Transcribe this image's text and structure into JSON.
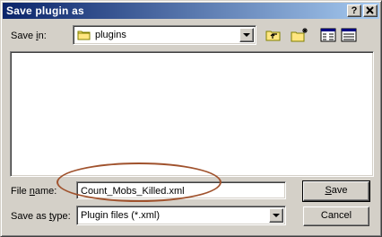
{
  "window": {
    "title": "Save plugin as",
    "help_glyph": "?",
    "close_glyph": "✕"
  },
  "save_in": {
    "label_pre": "Save ",
    "label_accel": "i",
    "label_post": "n:",
    "value": "plugins",
    "icon": "folder-icon"
  },
  "toolbar": {
    "up_folder_icon": "up-one-level-icon",
    "new_folder_icon": "new-folder-icon",
    "list_view_icon": "list-view-icon",
    "details_view_icon": "details-view-icon"
  },
  "file_name": {
    "label_pre": "File ",
    "label_accel": "n",
    "label_post": "ame:",
    "value": "Count_Mobs_Killed.xml"
  },
  "save_as_type": {
    "label_pre": "Save as ",
    "label_accel": "t",
    "label_post": "ype:",
    "value": "Plugin files (*.xml)"
  },
  "buttons": {
    "save_accel": "S",
    "save_rest": "ave",
    "cancel": "Cancel"
  },
  "annotation": {
    "color": "#a0522d"
  }
}
